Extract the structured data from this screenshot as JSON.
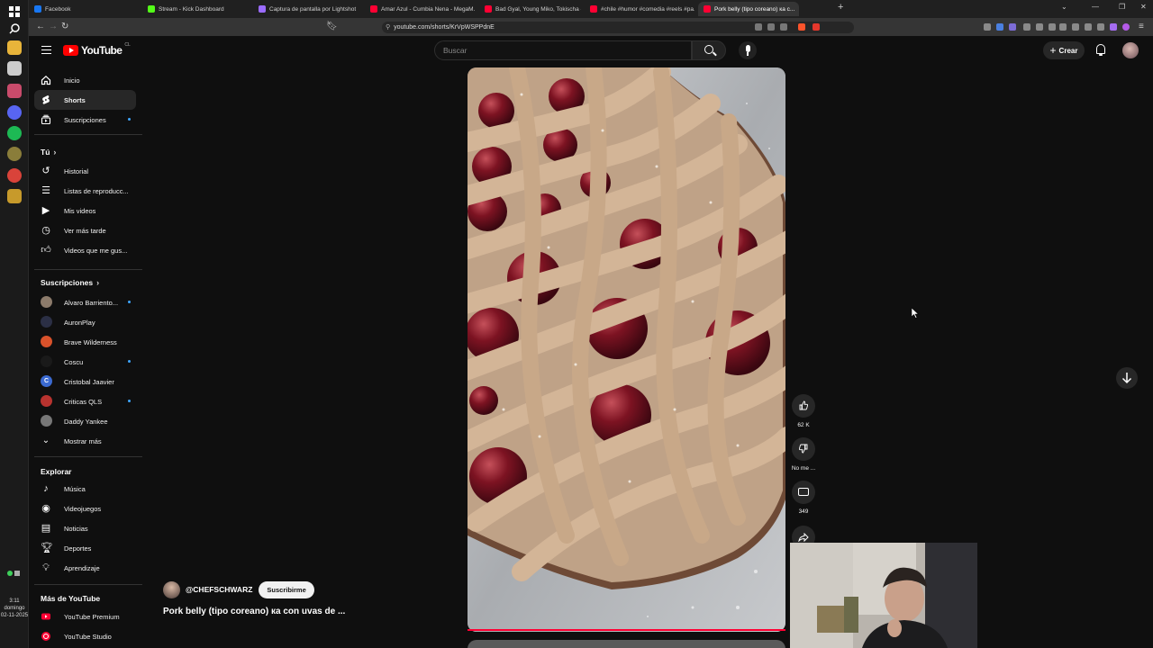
{
  "tabs": [
    {
      "title": "Facebook",
      "color": "#1877f2"
    },
    {
      "title": "Stream - Kick Dashboard",
      "color": "#53fc18"
    },
    {
      "title": "Captura de pantalla por Lightshot",
      "color": "#9b6cff"
    },
    {
      "title": "Amar Azul - Cumbia Nena - MegaM...",
      "color": "#ff0033"
    },
    {
      "title": "Bad Gyal, Young Miko, Tokischa - Ch...",
      "color": "#ff0033"
    },
    {
      "title": "#chile #humor #comedia #reels #pa...",
      "color": "#ff0033"
    },
    {
      "title": "Pork belly (tipo coreano) ка c...",
      "color": "#ff0033"
    }
  ],
  "address": {
    "url": "youtube.com/shorts/KrVpWSPPdnE"
  },
  "header": {
    "logo_text": "YouTube",
    "country": "CL",
    "search_placeholder": "Buscar",
    "create_label": "Crear"
  },
  "sidebar": {
    "main": [
      {
        "label": "Inicio",
        "icon": "home-icon"
      },
      {
        "label": "Shorts",
        "icon": "shorts-icon"
      },
      {
        "label": "Suscripciones",
        "icon": "subscriptions-icon"
      }
    ],
    "you_heading": "Tú",
    "you": [
      {
        "label": "Historial",
        "icon": "history-icon"
      },
      {
        "label": "Listas de reproducc...",
        "icon": "playlists-icon"
      },
      {
        "label": "Mis videos",
        "icon": "my-videos-icon"
      },
      {
        "label": "Ver más tarde",
        "icon": "watch-later-icon"
      },
      {
        "label": "Videos que me gus...",
        "icon": "liked-videos-icon"
      }
    ],
    "subs_heading": "Suscripciones",
    "subs": [
      {
        "label": "Alvaro Barriento...",
        "color": "#8c7b6b",
        "dot": true
      },
      {
        "label": "AuronPlay",
        "color": "#2b2f45",
        "dot": false
      },
      {
        "label": "Brave Wilderness",
        "color": "#d9522b",
        "dot": false
      },
      {
        "label": "Coscu",
        "color": "#1a1a1a",
        "dot": true
      },
      {
        "label": "Cristobal Jaavier",
        "color": "#3b6ad1",
        "dot": false,
        "letter": "C"
      },
      {
        "label": "Criticas QLS",
        "color": "#b8332f",
        "dot": true
      },
      {
        "label": "Daddy Yankee",
        "color": "#777777",
        "dot": false
      }
    ],
    "show_more": "Mostrar más",
    "explore_heading": "Explorar",
    "explore": [
      {
        "label": "Música",
        "icon": "music-icon"
      },
      {
        "label": "Videojuegos",
        "icon": "gaming-icon"
      },
      {
        "label": "Noticias",
        "icon": "news-icon"
      },
      {
        "label": "Deportes",
        "icon": "sports-icon"
      },
      {
        "label": "Aprendizaje",
        "icon": "learning-icon"
      }
    ],
    "more_heading": "Más de YouTube",
    "more": [
      {
        "label": "YouTube Premium"
      },
      {
        "label": "YouTube Studio"
      }
    ]
  },
  "short": {
    "channel": "@CHEFSCHWARZ",
    "subscribe": "Suscribirme",
    "title": "Pork belly (tipo coreano) ка con uvas de ...",
    "likes": "62 K",
    "dislike": "No me ...",
    "comments": "349",
    "progress": 1.0
  },
  "os": {
    "time": "3:11",
    "day": "domingo",
    "date": "02-11-2025"
  }
}
